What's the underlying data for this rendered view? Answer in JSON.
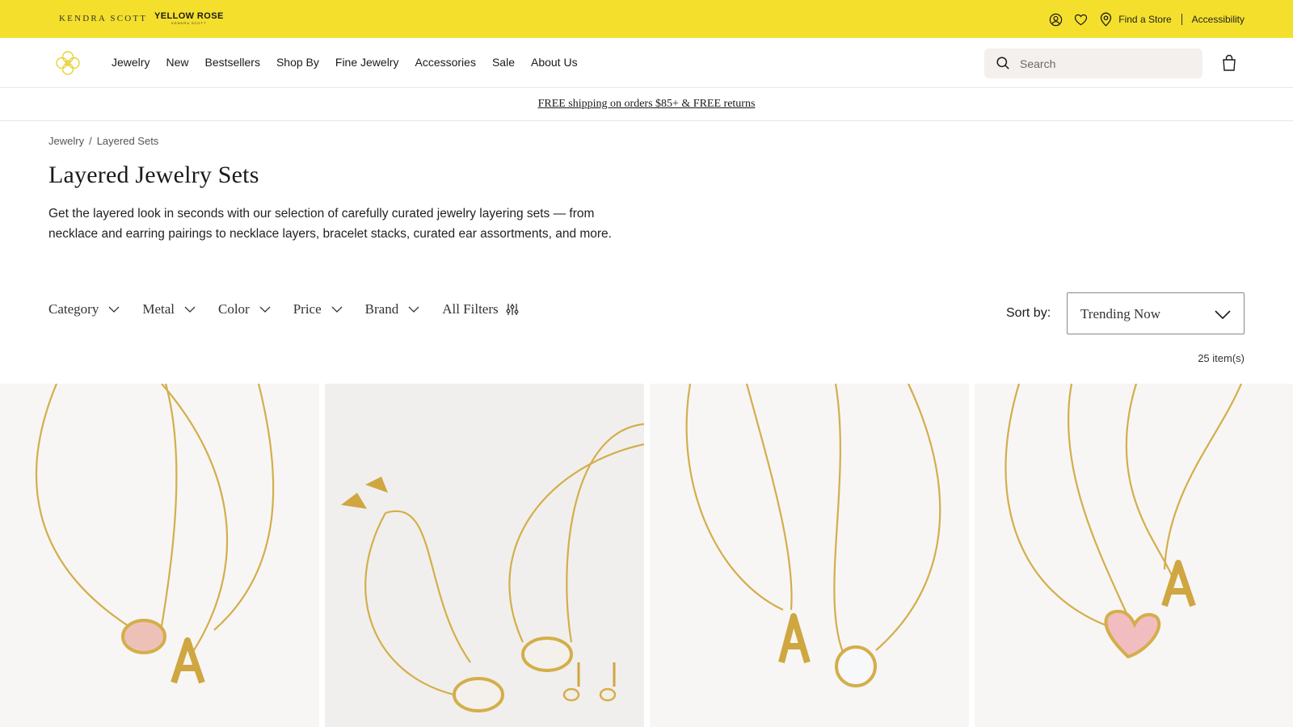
{
  "utility": {
    "brand_primary": "KENDRA SCOTT",
    "brand_secondary": "YELLOW ROSE",
    "brand_secondary_sub": "KENDRA SCOTT",
    "find_store": "Find a Store",
    "accessibility": "Accessibility",
    "icons": [
      "account-icon",
      "heart-icon",
      "map-pin-icon"
    ],
    "bar_color": "#f4e02c"
  },
  "nav": {
    "items": [
      "Jewelry",
      "New",
      "Bestsellers",
      "Shop By",
      "Fine Jewelry",
      "Accessories",
      "Sale",
      "About Us"
    ],
    "search_placeholder": "Search"
  },
  "promo": {
    "text": "FREE shipping on orders $85+ & FREE returns"
  },
  "breadcrumb": {
    "items": [
      "Jewelry",
      "Layered Sets"
    ],
    "separator": "/"
  },
  "page": {
    "title": "Layered Jewelry Sets",
    "description": "Get the layered look in seconds with our selection of carefully curated jewelry layering sets — from necklace and earring pairings to necklace layers, bracelet stacks, curated ear assortments, and more."
  },
  "filters": {
    "items": [
      "Category",
      "Metal",
      "Color",
      "Price",
      "Brand"
    ],
    "all_filters": "All Filters"
  },
  "sort": {
    "label": "Sort by:",
    "value": "Trending Now"
  },
  "results": {
    "count": "25 item(s)"
  },
  "products": [
    {
      "image": "pink-oval-pendant-and-letter-a-necklace-set"
    },
    {
      "image": "ivory-pearl-bracelet-necklace-and-stud-earrings-set"
    },
    {
      "image": "letter-a-and-white-opal-round-necklace-set"
    },
    {
      "image": "pink-heart-and-letter-a-necklace-set"
    }
  ]
}
